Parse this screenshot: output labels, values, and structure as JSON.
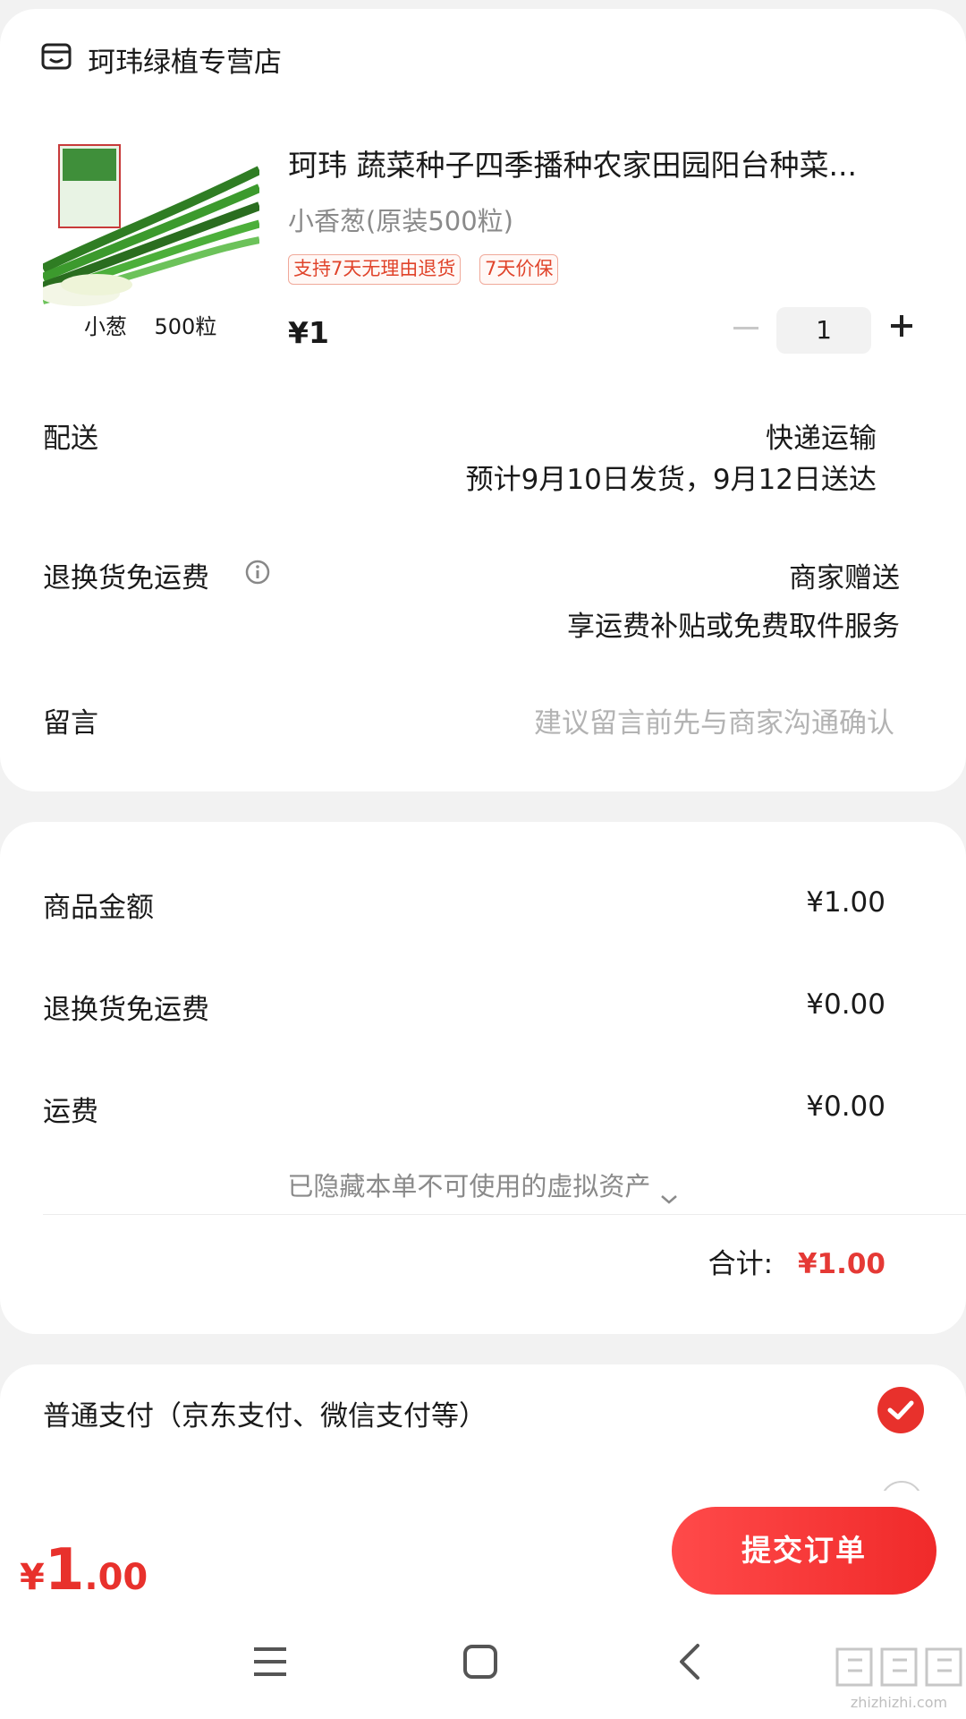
{
  "store": {
    "name": "珂玮绿植专营店"
  },
  "product": {
    "title": "珂玮 蔬菜种子四季播种农家田园阳台种菜...",
    "spec": "小香葱(原装500粒)",
    "tags": [
      "支持7天无理由退货",
      "7天价保"
    ],
    "price": "¥1",
    "quantity": "1",
    "image_caption": "小葱    500粒"
  },
  "delivery": {
    "label": "配送",
    "method": "快递运输",
    "estimate": "预计9月10日发货，9月12日送达"
  },
  "return_shipping": {
    "label": "退换货免运费",
    "value": "商家赠送",
    "desc": "享运费补贴或免费取件服务"
  },
  "message": {
    "label": "留言",
    "placeholder": "建议留言前先与商家沟通确认"
  },
  "summary": {
    "goods_label": "商品金额",
    "goods_value": "¥1.00",
    "return_label": "退换货免运费",
    "return_value": "¥0.00",
    "freight_label": "运费",
    "freight_value": "¥0.00",
    "hidden_assets": "已隐藏本单不可使用的虚拟资产",
    "total_label": "合计:",
    "total_value": "¥1.00"
  },
  "payment": {
    "option_label": "普通支付（京东支付、微信支付等）"
  },
  "bottom": {
    "currency": "¥",
    "price_int": "1",
    "price_dec": ".00",
    "submit_label": "提交订单"
  },
  "watermark": {
    "domain": "zhizhizhi.com"
  },
  "colors": {
    "accent": "#e53935",
    "background": "#f2f2f2"
  }
}
